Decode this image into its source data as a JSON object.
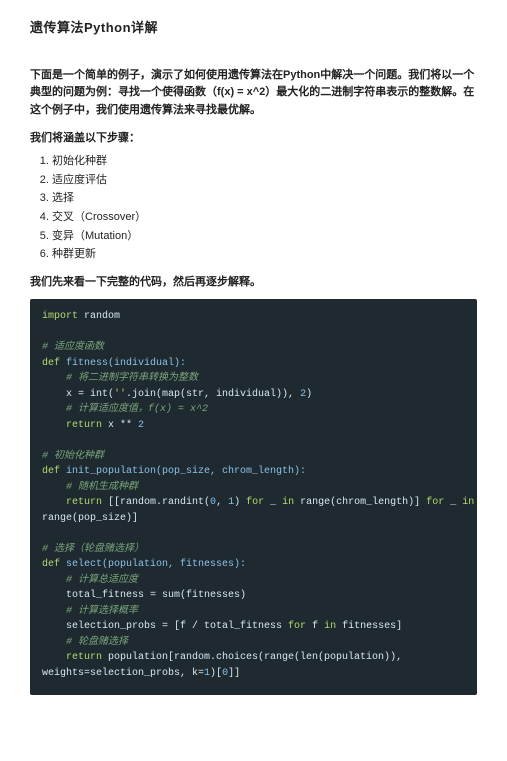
{
  "title": "遗传算法Python详解",
  "intro": "下面是一个简单的例子，演示了如何使用遗传算法在Python中解决一个问题。我们将以一个典型的问题为例：寻找一个使得函数（f(x) = x^2）最大化的二进制字符串表示的整数解。在这个例子中，我们使用遗传算法来寻找最优解。",
  "steps_lead": "我们将涵盖以下步骤：",
  "steps": [
    "初始化种群",
    "适应度评估",
    "选择",
    "交叉（Crossover）",
    "变异（Mutation）",
    "种群更新"
  ],
  "precode": "我们先来看一下完整的代码，然后再逐步解释。",
  "code": {
    "l01_import": "import",
    "l01_random": " random",
    "l03_cm": "# 适应度函数",
    "l04_def": "def",
    "l04_sig": " fitness(individual):",
    "l05_cm": "    # 将二进制字符串转换为整数",
    "l06_a": "    x = int(",
    "l06_str": "''",
    "l06_b": ".join(map(str, individual)), ",
    "l06_two": "2",
    "l06_c": ")",
    "l07_cm": "    # 计算适应度值，f(x) = x^2",
    "l08_ret": "    return",
    "l08_rest": " x ** ",
    "l08_two": "2",
    "l10_cm": "# 初始化种群",
    "l11_def": "def",
    "l11_sig": " init_population(pop_size, chrom_length):",
    "l12_cm": "    # 随机生成种群",
    "l13_ret": "    return",
    "l13_a": " [[random.randint(",
    "l13_z": "0",
    "l13_b": ", ",
    "l13_o": "1",
    "l13_c": ") ",
    "l13_for1": "for",
    "l13_d": " _ ",
    "l13_in1": "in",
    "l13_e": " range(chrom_length)] ",
    "l13_for2": "for",
    "l13_f": " _ ",
    "l13_in2": "in",
    "l14_a": "range(pop_size)]",
    "l16_cm": "# 选择（轮盘赌选择）",
    "l17_def": "def",
    "l17_sig": " select(population, fitnesses):",
    "l18_cm": "    # 计算总适应度",
    "l19": "    total_fitness = sum(fitnesses)",
    "l20_cm": "    # 计算选择概率",
    "l21_a": "    selection_probs = [f / total_fitness ",
    "l21_for": "for",
    "l21_b": " f ",
    "l21_in": "in",
    "l21_c": " fitnesses]",
    "l22_cm": "    # 轮盘赌选择",
    "l23_ret": "    return",
    "l23_a": " population[random.choices(range(len(population)),",
    "l24_a": "weights=selection_probs, k=",
    "l24_one": "1",
    "l24_b": ")[",
    "l24_z": "0",
    "l24_c": "]]"
  }
}
